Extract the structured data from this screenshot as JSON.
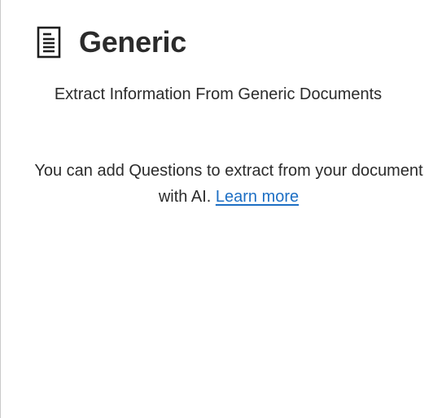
{
  "header": {
    "icon": "document-icon",
    "title": "Generic"
  },
  "subtitle": "Extract Information From Generic Documents",
  "info": {
    "text": "You can add Questions to extract from your document with AI.",
    "link_label": "Learn more",
    "link_color": "#1d6fc4"
  }
}
